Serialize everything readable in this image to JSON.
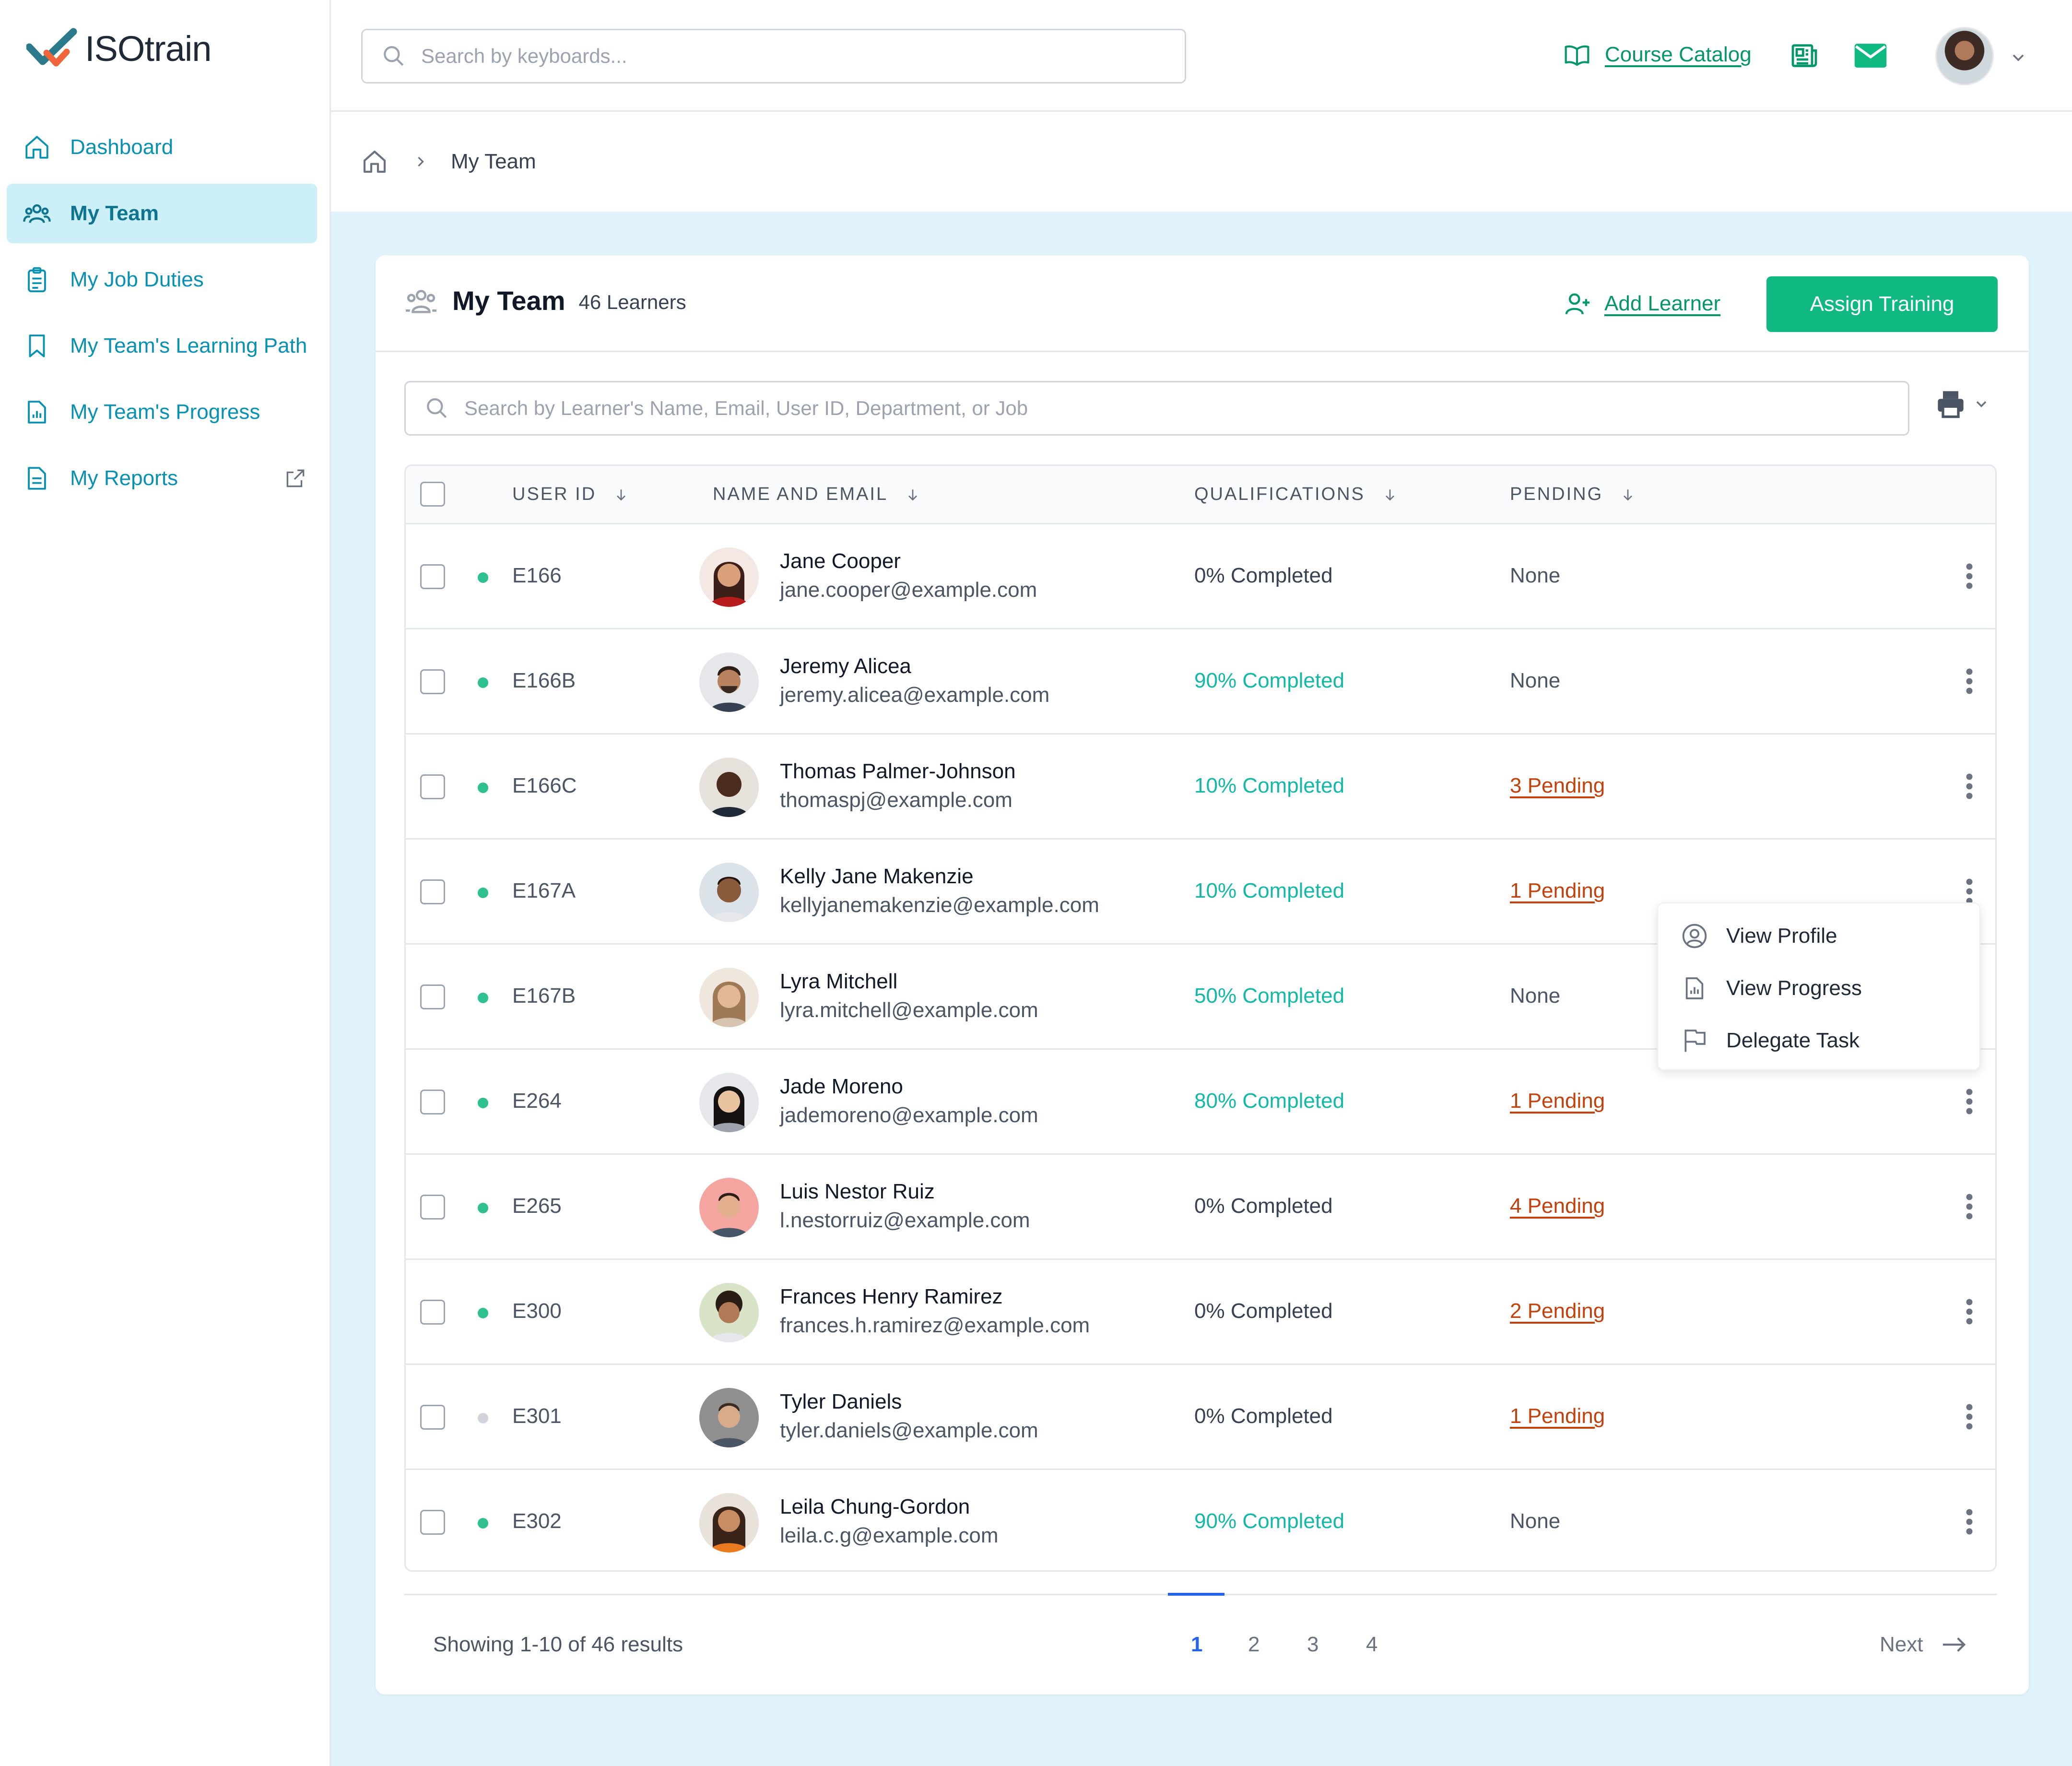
{
  "app": {
    "name": "ISOtrain"
  },
  "colors": {
    "brand": "#10b981",
    "nav": "#0891b2",
    "active_bg": "#cdeff8",
    "pending": "#c2410c",
    "progress": "#14b8a6",
    "link_blue": "#2563eb"
  },
  "sidebar": {
    "items": [
      {
        "label": "Dashboard",
        "icon": "home-icon"
      },
      {
        "label": "My Team",
        "icon": "team-icon",
        "active": true
      },
      {
        "label": "My Job Duties",
        "icon": "clipboard-icon"
      },
      {
        "label": "My Team's Learning Path",
        "icon": "bookmark-icon"
      },
      {
        "label": "My Team's Progress",
        "icon": "chart-file-icon"
      },
      {
        "label": "My Reports",
        "icon": "document-icon",
        "external": true
      }
    ]
  },
  "topbar": {
    "search_placeholder": "Search by keyboards...",
    "course_catalog": "Course Catalog"
  },
  "breadcrumb": {
    "current": "My Team"
  },
  "card": {
    "title": "My Team",
    "count": "46 Learners",
    "add_learner": "Add Learner",
    "assign_training": "Assign Training",
    "search_placeholder": "Search by Learner's Name, Email, User ID, Department, or Job"
  },
  "table": {
    "headers": {
      "user_id": "USER ID",
      "name_email": "NAME AND EMAIL",
      "qualifications": "QUALIFICATIONS",
      "pending": "PENDING"
    },
    "rows": [
      {
        "id": "E166",
        "name": "Jane Cooper",
        "email": "jane.cooper@example.com",
        "qual": "0% Completed",
        "pending": "None",
        "online": true
      },
      {
        "id": "E166B",
        "name": "Jeremy Alicea",
        "email": "jeremy.alicea@example.com",
        "qual": "90% Completed",
        "pending": "None",
        "online": true
      },
      {
        "id": "E166C",
        "name": "Thomas Palmer-Johnson",
        "email": "thomaspj@example.com",
        "qual": "10% Completed",
        "pending": "3 Pending",
        "online": true
      },
      {
        "id": "E167A",
        "name": "Kelly Jane Makenzie",
        "email": "kellyjanemakenzie@example.com",
        "qual": "10% Completed",
        "pending": "1 Pending",
        "online": true
      },
      {
        "id": "E167B",
        "name": "Lyra Mitchell",
        "email": "lyra.mitchell@example.com",
        "qual": "50% Completed",
        "pending": "None",
        "online": true
      },
      {
        "id": "E264",
        "name": "Jade Moreno",
        "email": "jademoreno@example.com",
        "qual": "80% Completed",
        "pending": "1 Pending",
        "online": true
      },
      {
        "id": "E265",
        "name": "Luis Nestor Ruiz",
        "email": "l.nestorruiz@example.com",
        "qual": "0% Completed",
        "pending": "4 Pending",
        "online": true
      },
      {
        "id": "E300",
        "name": "Frances Henry Ramirez",
        "email": "frances.h.ramirez@example.com",
        "qual": "0% Completed",
        "pending": "2 Pending",
        "online": true
      },
      {
        "id": "E301",
        "name": "Tyler Daniels",
        "email": "tyler.daniels@example.com",
        "qual": "0% Completed",
        "pending": "1 Pending",
        "online": false
      },
      {
        "id": "E302",
        "name": "Leila Chung-Gordon",
        "email": "leila.c.g@example.com",
        "qual": "90% Completed",
        "pending": "None",
        "online": true
      }
    ]
  },
  "row_menu": {
    "view_profile": "View Profile",
    "view_progress": "View Progress",
    "delegate_task": "Delegate Task"
  },
  "pagination": {
    "showing": "Showing 1-10 of 46 results",
    "pages": [
      "1",
      "2",
      "3",
      "4"
    ],
    "current": "1",
    "next": "Next"
  }
}
